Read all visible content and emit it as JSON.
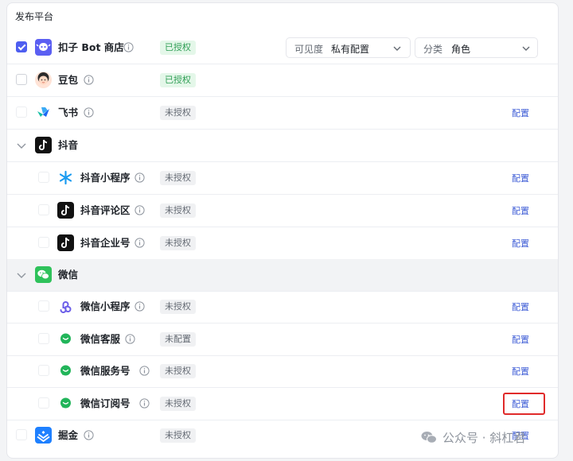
{
  "section_title": "发布平台",
  "labels": {
    "config": "配置",
    "authorized": "已授权",
    "unauthorized": "未授权",
    "unconfigured": "未配置"
  },
  "coze": {
    "name": "扣子 Bot 商店",
    "status": "已授权",
    "checked": true,
    "visibility_label": "可见度",
    "visibility_value": "私有配置",
    "category_label": "分类",
    "category_value": "角色"
  },
  "doubao": {
    "name": "豆包",
    "status": "已授权"
  },
  "feishu": {
    "name": "飞书",
    "status": "未授权",
    "action": "配置"
  },
  "douyin": {
    "group": "抖音",
    "children": [
      {
        "name": "抖音小程序",
        "status": "未授权",
        "action": "配置"
      },
      {
        "name": "抖音评论区",
        "status": "未授权",
        "action": "配置"
      },
      {
        "name": "抖音企业号",
        "status": "未授权",
        "action": "配置"
      }
    ]
  },
  "wechat": {
    "group": "微信",
    "children": [
      {
        "name": "微信小程序",
        "status": "未授权",
        "action": "配置"
      },
      {
        "name": "微信客服",
        "status": "未配置",
        "action": "配置"
      },
      {
        "name": "微信服务号",
        "status": "未授权",
        "action": "配置"
      },
      {
        "name": "微信订阅号",
        "status": "未授权",
        "action": "配置"
      }
    ]
  },
  "juejin": {
    "name": "掘金",
    "status": "未授权",
    "action": "配置"
  },
  "watermark": "公众号 · 斜杠君",
  "colors": {
    "accent": "#4e5ef0",
    "link": "#3c5bd6",
    "authorized_bg": "#e4f7e9",
    "authorized_text": "#2f9e55",
    "highlight": "#e02a2a"
  }
}
